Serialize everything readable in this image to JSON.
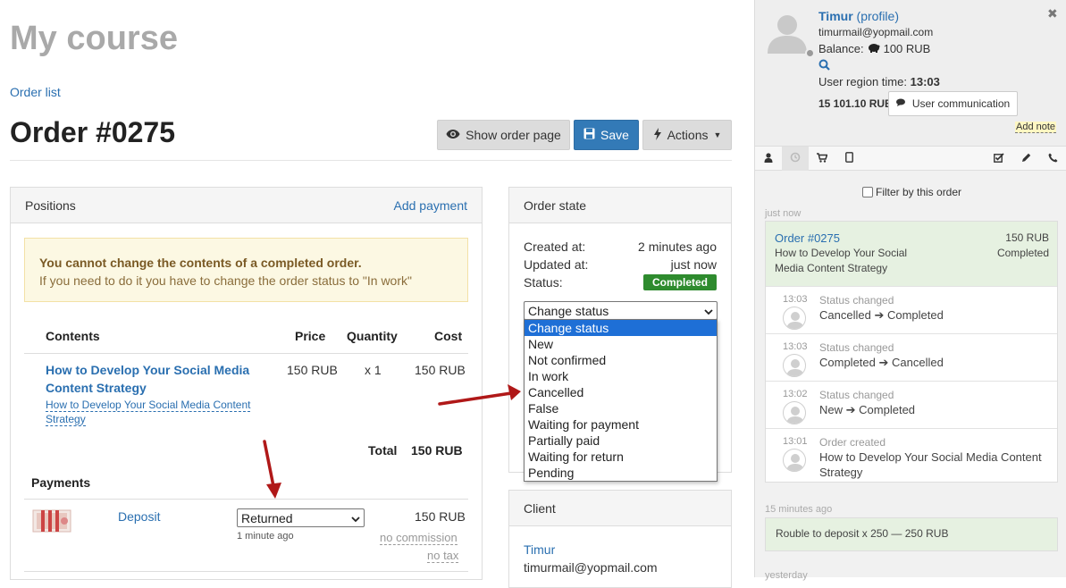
{
  "page": {
    "course_title": "My course",
    "order_list_link": "Order list",
    "order_title": "Order #0275",
    "toolbar": {
      "show_order_page": "Show order page",
      "save": "Save",
      "actions": "Actions"
    }
  },
  "positions": {
    "title": "Positions",
    "add_payment": "Add payment",
    "warning_title": "You cannot change the contents of a completed order.",
    "warning_text": "If you need to do it you have to change the order status to \"In work\"",
    "columns": {
      "contents": "Contents",
      "price": "Price",
      "quantity": "Quantity",
      "cost": "Cost"
    },
    "row": {
      "title": "How to Develop Your Social Media Content Strategy",
      "subtitle": "How to Develop Your Social Media Content Strategy",
      "price": "150 RUB",
      "quantity": "x 1",
      "cost": "150 RUB"
    },
    "total_label": "Total",
    "total_value": "150 RUB",
    "payments_title": "Payments",
    "payment": {
      "name": "Deposit",
      "status": "Returned",
      "time": "1 minute ago",
      "amount": "150 RUB",
      "commission": "no commission",
      "tax": "no tax"
    }
  },
  "order_state": {
    "title": "Order state",
    "created_label": "Created at:",
    "created_value": "2 minutes ago",
    "updated_label": "Updated at:",
    "updated_value": "just now",
    "status_label": "Status:",
    "status_value": "Completed",
    "status_color": "#2e8b2e",
    "change_status_select": "Change status",
    "options": [
      "Change status",
      "New",
      "Not confirmed",
      "In work",
      "Cancelled",
      "False",
      "Waiting for payment",
      "Partially paid",
      "Waiting for return",
      "Pending"
    ]
  },
  "client": {
    "title": "Client",
    "name": "Timur",
    "email": "timurmail@yopmail.com"
  },
  "side": {
    "user_name": "Timur",
    "profile_link": "(profile)",
    "email": "timurmail@yopmail.com",
    "balance_label": "Balance:",
    "balance_value": "100 RUB",
    "region_time_label": "User region time:",
    "region_time_value": "13:03",
    "total_spent": "15 101.10 RUB",
    "user_communication": "User communication",
    "add_note": "Add note",
    "filter_label": "Filter by this order",
    "group_just_now": "just now",
    "order_card": {
      "link": "Order #0275",
      "amount": "150 RUB",
      "title": "How to Develop Your Social Media Content Strategy",
      "status": "Completed"
    },
    "events": [
      {
        "time": "13:03",
        "title": "Status changed",
        "from": "Cancelled",
        "to": "Completed"
      },
      {
        "time": "13:03",
        "title": "Status changed",
        "from": "Completed",
        "to": "Cancelled"
      },
      {
        "time": "13:02",
        "title": "Status changed",
        "from": "New",
        "to": "Completed"
      },
      {
        "time": "13:01",
        "title": "Order created",
        "text": "How to Develop Your Social Media Content Strategy"
      }
    ],
    "group_15_min": "15 minutes ago",
    "deposit_card": "Rouble to deposit x 250 — 250 RUB",
    "group_yesterday": "yesterday"
  },
  "colors": {
    "accent": "#337ab7",
    "link": "#2a6fb0",
    "success": "#2e8b2e",
    "arrow": "#b01818"
  }
}
